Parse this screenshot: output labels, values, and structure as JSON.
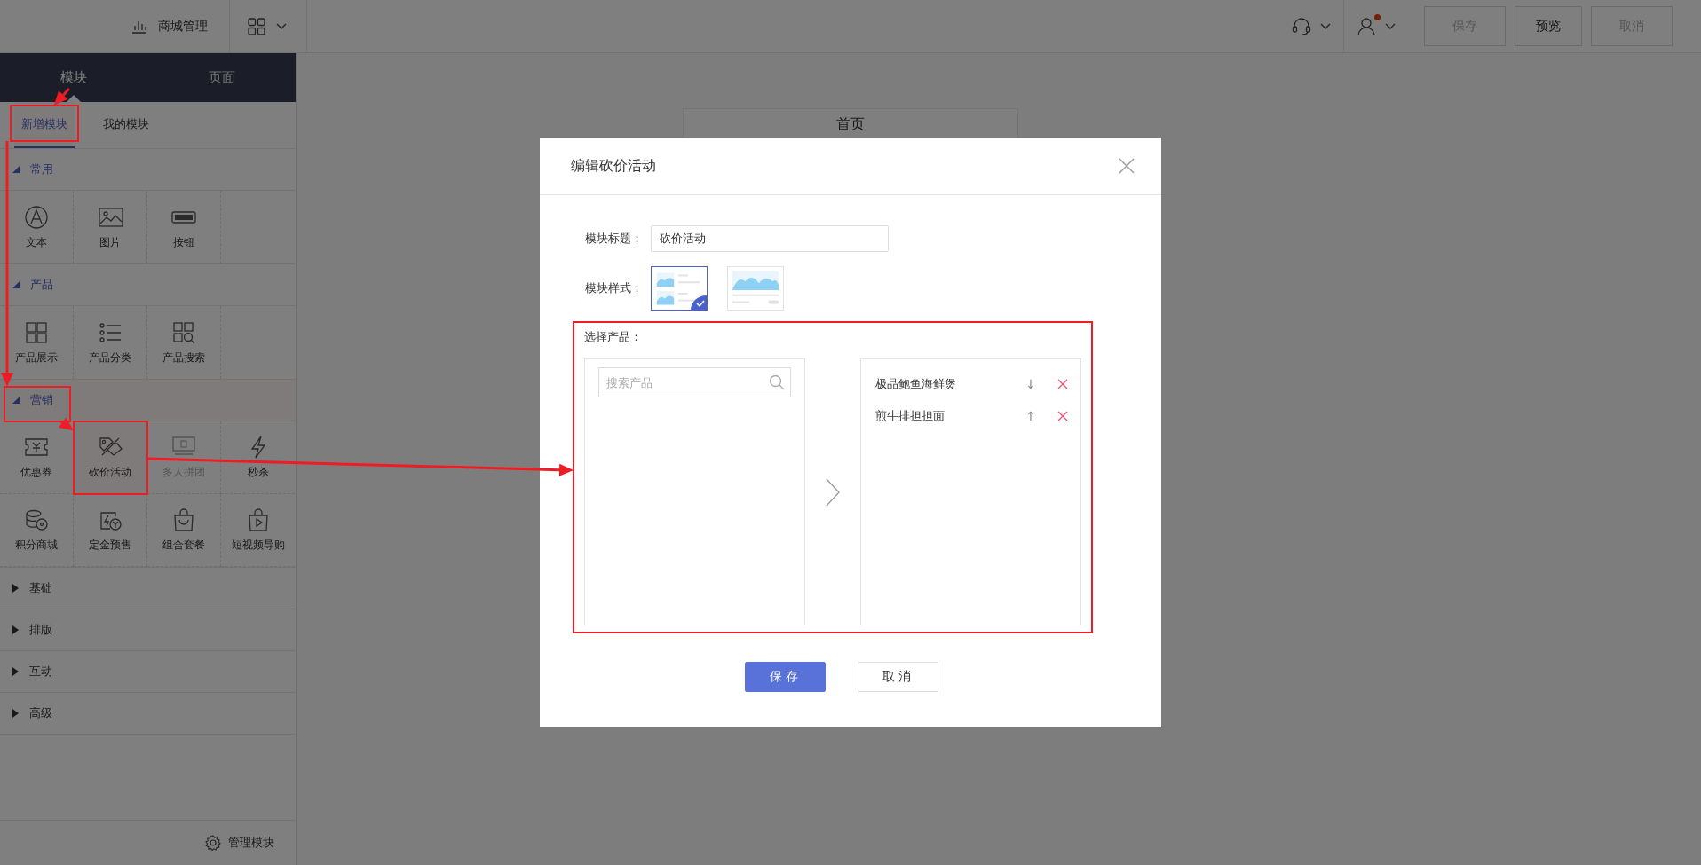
{
  "topbar": {
    "store_label": "商城管理",
    "notification": true,
    "buttons": [
      {
        "label": "保存",
        "disabled": true
      },
      {
        "label": "预览",
        "disabled": false
      },
      {
        "label": "取消",
        "disabled": true
      }
    ]
  },
  "sidebar": {
    "tabs": [
      {
        "label": "模块",
        "selected": true
      },
      {
        "label": "页面",
        "selected": false
      }
    ],
    "sub_tabs": [
      {
        "label": "新增模块",
        "selected": true,
        "highlighted": true
      },
      {
        "label": "我的模块",
        "selected": false,
        "highlighted": false
      }
    ],
    "sections": [
      {
        "label": "常用",
        "expanded": true,
        "highlighted": false,
        "items": [
          {
            "label": "文本",
            "kind": "text",
            "disabled": false,
            "highlighted": false
          },
          {
            "label": "图片",
            "kind": "image",
            "disabled": false,
            "highlighted": false
          },
          {
            "label": "按钮",
            "kind": "button",
            "disabled": false,
            "highlighted": false
          }
        ]
      },
      {
        "label": "产品",
        "expanded": true,
        "highlighted": false,
        "items": [
          {
            "label": "产品展示",
            "kind": "grid",
            "disabled": false,
            "highlighted": false
          },
          {
            "label": "产品分类",
            "kind": "list",
            "disabled": false,
            "highlighted": false
          },
          {
            "label": "产品搜索",
            "kind": "search",
            "disabled": false,
            "highlighted": false
          }
        ]
      },
      {
        "label": "营销",
        "expanded": true,
        "highlighted": true,
        "items": [
          {
            "label": "优惠券",
            "kind": "coupon",
            "disabled": false,
            "highlighted": false
          },
          {
            "label": "砍价活动",
            "kind": "tag",
            "disabled": false,
            "highlighted": true
          },
          {
            "label": "多人拼团",
            "kind": "group",
            "disabled": true,
            "highlighted": false
          },
          {
            "label": "秒杀",
            "kind": "flash",
            "disabled": false,
            "highlighted": false
          },
          {
            "label": "积分商城",
            "kind": "coins",
            "disabled": false,
            "highlighted": false
          },
          {
            "label": "定金预售",
            "kind": "deposit",
            "disabled": false,
            "highlighted": false
          },
          {
            "label": "组合套餐",
            "kind": "bag",
            "disabled": false,
            "highlighted": false
          },
          {
            "label": "短视频导购",
            "kind": "video",
            "disabled": false,
            "highlighted": false
          }
        ]
      },
      {
        "label": "基础",
        "expanded": false,
        "highlighted": false
      },
      {
        "label": "排版",
        "expanded": false,
        "highlighted": false
      },
      {
        "label": "互动",
        "expanded": false,
        "highlighted": false
      },
      {
        "label": "高级",
        "expanded": false,
        "highlighted": false
      }
    ],
    "footer": "管理模块"
  },
  "canvas": {
    "page_title": "首页"
  },
  "modal": {
    "title": "编辑砍价活动",
    "title_label": "模块标题：",
    "title_value": "砍价活动",
    "style_label": "模块样式：",
    "styles": [
      {
        "kind": "list",
        "selected": true
      },
      {
        "kind": "large",
        "selected": false
      }
    ],
    "product_section": {
      "label": "选择产品：",
      "highlighted": true,
      "search_placeholder": "搜索产品",
      "selected_products": [
        {
          "name": "极品鲍鱼海鲜煲",
          "move": "↓"
        },
        {
          "name": "煎牛排担担面",
          "move": "↑"
        }
      ]
    },
    "buttons": [
      {
        "label": "保存",
        "primary": true
      },
      {
        "label": "取消",
        "primary": false
      }
    ]
  }
}
